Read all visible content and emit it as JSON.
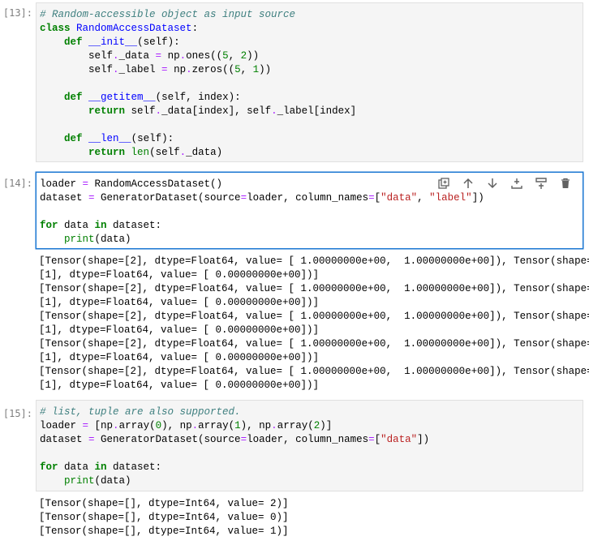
{
  "cells": [
    {
      "prompt": "[13]:",
      "code": [
        "# Random-accessible object as input source",
        "class RandomAccessDataset:",
        "    def __init__(self):",
        "        self._data = np.ones((5, 2))",
        "        self._label = np.zeros((5, 1))",
        "",
        "    def __getitem__(self, index):",
        "        return self._data[index], self._label[index]",
        "",
        "    def __len__(self):",
        "        return len(self._data)"
      ]
    },
    {
      "prompt": "[14]:",
      "code": [
        "loader = RandomAccessDataset()",
        "dataset = GeneratorDataset(source=loader, column_names=[\"data\", \"label\"])",
        "",
        "for data in dataset:",
        "    print(data)"
      ],
      "output": [
        "[Tensor(shape=[2], dtype=Float64, value= [ 1.00000000e+00,  1.00000000e+00]), Tensor(shape=",
        "[1], dtype=Float64, value= [ 0.00000000e+00])]",
        "[Tensor(shape=[2], dtype=Float64, value= [ 1.00000000e+00,  1.00000000e+00]), Tensor(shape=",
        "[1], dtype=Float64, value= [ 0.00000000e+00])]",
        "[Tensor(shape=[2], dtype=Float64, value= [ 1.00000000e+00,  1.00000000e+00]), Tensor(shape=",
        "[1], dtype=Float64, value= [ 0.00000000e+00])]",
        "[Tensor(shape=[2], dtype=Float64, value= [ 1.00000000e+00,  1.00000000e+00]), Tensor(shape=",
        "[1], dtype=Float64, value= [ 0.00000000e+00])]",
        "[Tensor(shape=[2], dtype=Float64, value= [ 1.00000000e+00,  1.00000000e+00]), Tensor(shape=",
        "[1], dtype=Float64, value= [ 0.00000000e+00])]"
      ]
    },
    {
      "prompt": "[15]:",
      "code": [
        "# list, tuple are also supported.",
        "loader = [np.array(0), np.array(1), np.array(2)]",
        "dataset = GeneratorDataset(source=loader, column_names=[\"data\"])",
        "",
        "for data in dataset:",
        "    print(data)"
      ],
      "output": [
        "[Tensor(shape=[], dtype=Int64, value= 2)]",
        "[Tensor(shape=[], dtype=Int64, value= 0)]",
        "[Tensor(shape=[], dtype=Int64, value= 1)]"
      ]
    }
  ],
  "toolbar": {
    "icons": [
      "duplicate-icon",
      "move-up-icon",
      "move-down-icon",
      "insert-above-icon",
      "insert-below-icon",
      "delete-icon"
    ],
    "accent_color": "#1976d2"
  }
}
